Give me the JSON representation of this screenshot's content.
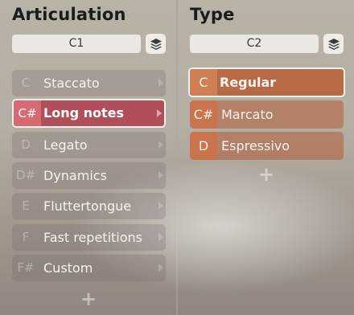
{
  "articulation": {
    "title": "Articulation",
    "key_value": "C1",
    "items": [
      {
        "note": "C",
        "label": "Staccato"
      },
      {
        "note": "C#",
        "label": "Long notes"
      },
      {
        "note": "D",
        "label": "Legato"
      },
      {
        "note": "D#",
        "label": "Dynamics"
      },
      {
        "note": "E",
        "label": "Fluttertongue"
      },
      {
        "note": "F",
        "label": "Fast repetitions"
      },
      {
        "note": "F#",
        "label": "Custom"
      }
    ],
    "selected_index": 1,
    "add_label": "+"
  },
  "type": {
    "title": "Type",
    "key_value": "C2",
    "items": [
      {
        "note": "C",
        "label": "Regular"
      },
      {
        "note": "C#",
        "label": "Marcato"
      },
      {
        "note": "D",
        "label": "Espressivo"
      }
    ],
    "selected_index": 0,
    "add_label": "+"
  },
  "icons": {
    "layers": "layers-icon",
    "chevron": "chevron-right-icon",
    "add": "plus-icon"
  },
  "colors": {
    "articulation_selected": "#b04e5a",
    "type_item": "#b86a47"
  }
}
